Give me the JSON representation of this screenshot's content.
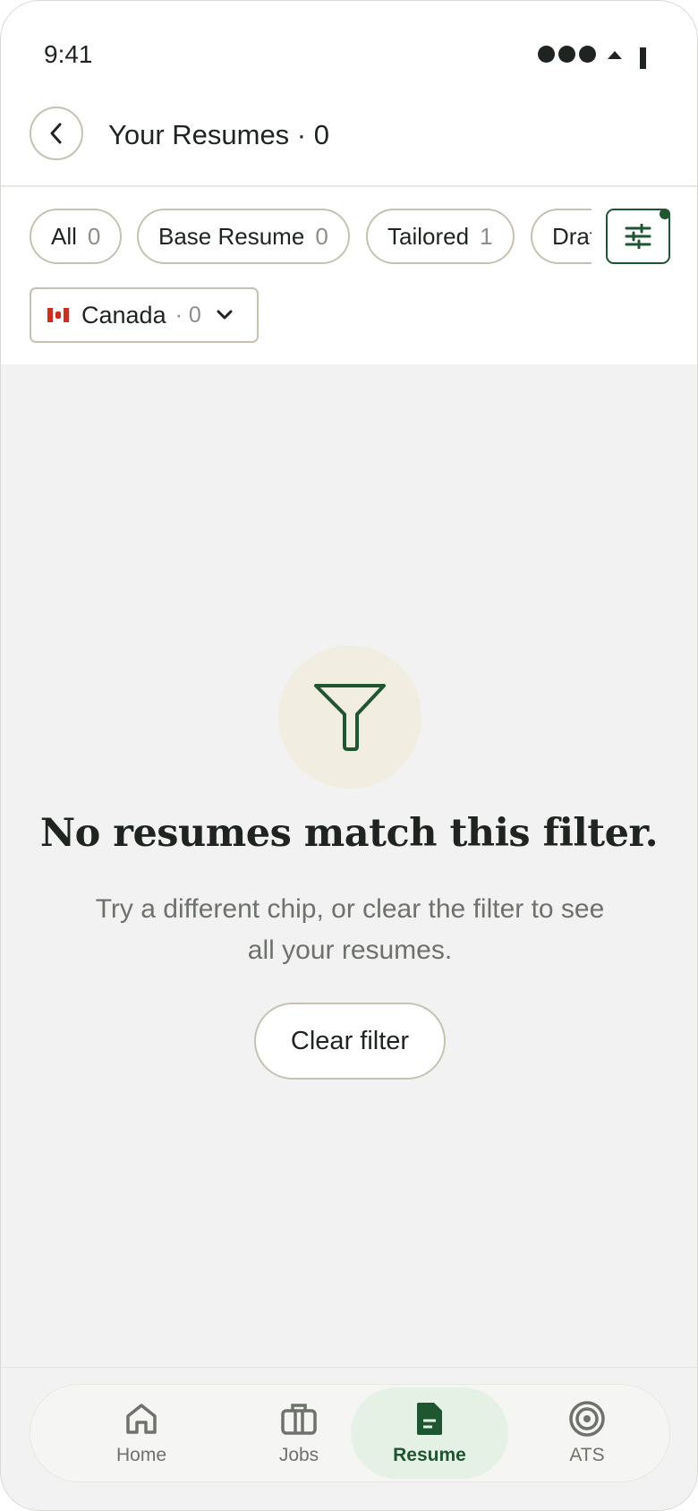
{
  "status_bar": {
    "time": "9:41"
  },
  "header": {
    "title": "Your Resumes · 0"
  },
  "chips": [
    {
      "label": "All",
      "count": "0"
    },
    {
      "label": "Base Resume",
      "count": "0"
    },
    {
      "label": "Tailored",
      "count": "1"
    },
    {
      "label": "Drafts",
      "count": ""
    }
  ],
  "country_filter": {
    "label": "Canada",
    "count": "· 0"
  },
  "empty_state": {
    "title": "No resumes match this filter.",
    "subtitle": "Try a different chip, or clear the filter to see all your resumes.",
    "button": "Clear filter"
  },
  "nav": {
    "items": [
      {
        "label": "Home",
        "icon": "home-icon"
      },
      {
        "label": "Jobs",
        "icon": "briefcase-icon"
      },
      {
        "label": "Resume",
        "icon": "document-icon",
        "active": true
      },
      {
        "label": "ATS",
        "icon": "target-icon"
      }
    ]
  },
  "colors": {
    "accent": "#1e5631",
    "chip_border": "#c5c2b1",
    "active_nav_bg": "#e6f1e6",
    "empty_icon_bg": "#f1ede1"
  }
}
